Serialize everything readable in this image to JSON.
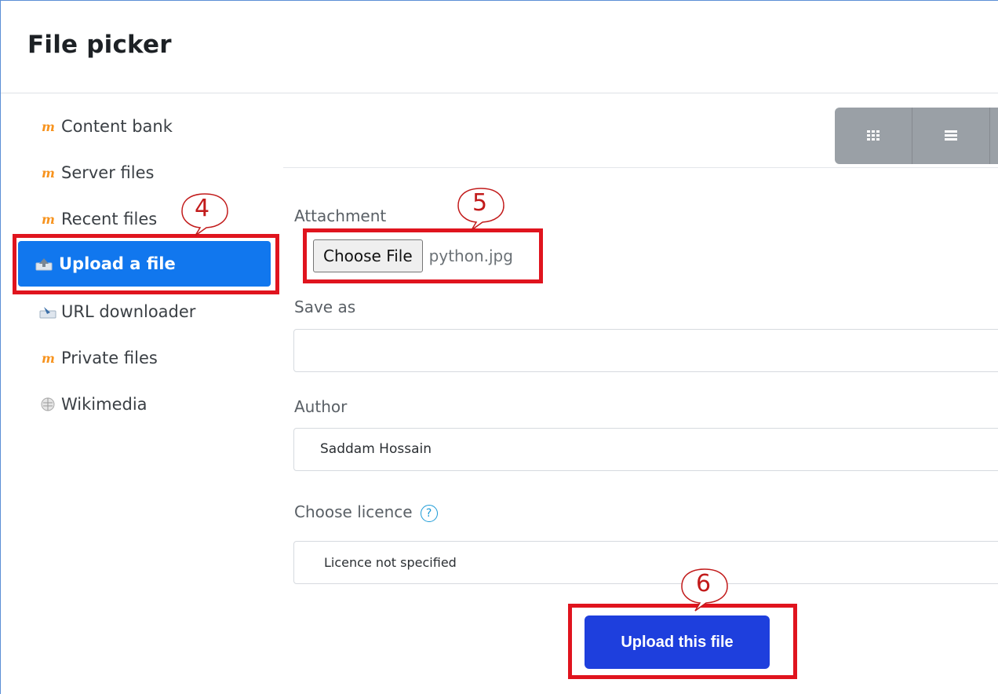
{
  "window": {
    "title": "File picker"
  },
  "sidebar": {
    "items": [
      {
        "label": "Content bank",
        "icon": "moodle-icon"
      },
      {
        "label": "Server files",
        "icon": "moodle-icon"
      },
      {
        "label": "Recent files",
        "icon": "moodle-icon"
      },
      {
        "label": "Upload a file",
        "icon": "upload-icon",
        "active": true
      },
      {
        "label": "URL downloader",
        "icon": "url-downloader-icon"
      },
      {
        "label": "Private files",
        "icon": "moodle-icon"
      },
      {
        "label": "Wikimedia",
        "icon": "wikimedia-icon"
      }
    ]
  },
  "toolbar": {
    "views": [
      {
        "icon": "grid-view-icon"
      },
      {
        "icon": "list-view-icon"
      }
    ]
  },
  "form": {
    "attachment_label": "Attachment",
    "choose_file_label": "Choose File",
    "file_name": "python.jpg",
    "save_as_label": "Save as",
    "save_as_value": "",
    "author_label": "Author",
    "author_value": "Saddam Hossain",
    "licence_label": "Choose licence",
    "licence_value": "Licence not specified",
    "upload_label": "Upload this file"
  },
  "annotations": [
    {
      "number": "4",
      "target": "Upload a file"
    },
    {
      "number": "5",
      "target": "Choose File"
    },
    {
      "number": "6",
      "target": "Upload this file"
    }
  ],
  "colors": {
    "active_item": "#1177ee",
    "upload_button": "#1e3fdd",
    "annotation": "#e0141e",
    "view_toolbar": "#9aa0a6"
  }
}
